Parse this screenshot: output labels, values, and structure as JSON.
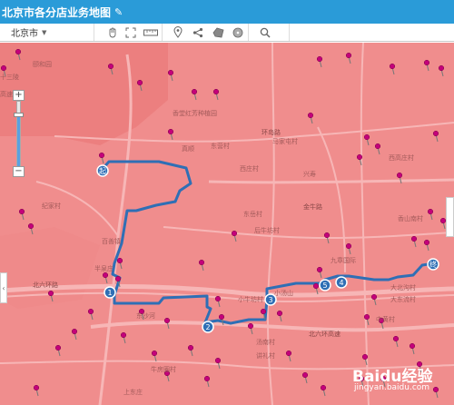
{
  "title": "北京市各分店业务地图",
  "toolbar": {
    "city": "北京市",
    "icons": [
      "hand-icon",
      "fullscreen-icon",
      "ruler-icon",
      "marker-icon",
      "share-icon",
      "polygon-icon",
      "circle-icon",
      "search-icon"
    ]
  },
  "zoom": {
    "plus": "+",
    "minus": "−",
    "level_fraction": 0.78
  },
  "places": [
    {
      "text": "颐和园"
    },
    {
      "text": "十三陵"
    },
    {
      "text": "高速站"
    },
    {
      "text": "香堂红芳种植园"
    },
    {
      "text": "真顺"
    },
    {
      "text": "东营村"
    },
    {
      "text": "环岛路"
    },
    {
      "text": "西庄村"
    },
    {
      "text": "马家屯村"
    },
    {
      "text": "西高庄村"
    },
    {
      "text": "兴寿"
    },
    {
      "text": "香山南村"
    },
    {
      "text": "纪家村"
    },
    {
      "text": "东岳村"
    },
    {
      "text": "后牛坊村"
    },
    {
      "text": "金牛路"
    },
    {
      "text": "九章国际"
    },
    {
      "text": "小汤山"
    },
    {
      "text": "大北沟村"
    },
    {
      "text": "中黄村"
    },
    {
      "text": "大东流村"
    },
    {
      "text": "半泉庄"
    },
    {
      "text": "北六环路"
    },
    {
      "text": "小牛坊村"
    },
    {
      "text": "北六环高速"
    },
    {
      "text": "汤南村"
    },
    {
      "text": "百善镇"
    },
    {
      "text": "讲礼村"
    },
    {
      "text": "牛房圈村"
    },
    {
      "text": "上东庄"
    },
    {
      "text": "东沙河"
    }
  ],
  "route_stops": [
    "起",
    "1",
    "2",
    "3",
    "5",
    "4",
    "终"
  ],
  "watermark": {
    "brand": "Baidu经验",
    "url": "jingyan.baidu.com"
  },
  "map_colors": {
    "base": "#f08d8d",
    "route": "#2f6fb5",
    "road": "#f7b6b6",
    "pin": "#c4007a"
  }
}
